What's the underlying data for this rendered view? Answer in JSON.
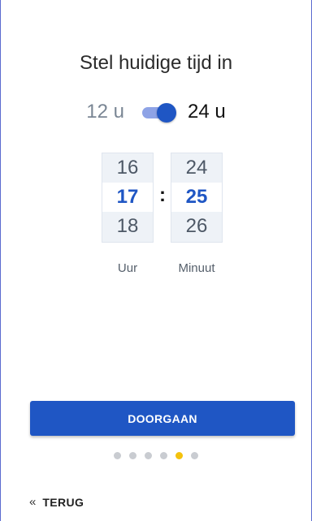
{
  "title": "Stel huidige tijd in",
  "time_format": {
    "option_12": "12 u",
    "option_24": "24 u",
    "selected": "24 u"
  },
  "pickers": {
    "hours": {
      "values": [
        "16",
        "17",
        "18"
      ],
      "selected": "17",
      "label": "Uur"
    },
    "separator": ":",
    "minutes": {
      "values": [
        "24",
        "25",
        "26"
      ],
      "selected": "25",
      "label": "Minuut"
    }
  },
  "continue_label": "DOORGAAN",
  "pagination": {
    "total": 6,
    "current": 5
  },
  "back": {
    "icon": "double-chevron-left-icon",
    "chevron_glyph": "«",
    "label": "TERUG"
  },
  "colors": {
    "accent": "#1f56c4",
    "active_dot": "#f4c20d",
    "frame": "#5b6bd0"
  }
}
